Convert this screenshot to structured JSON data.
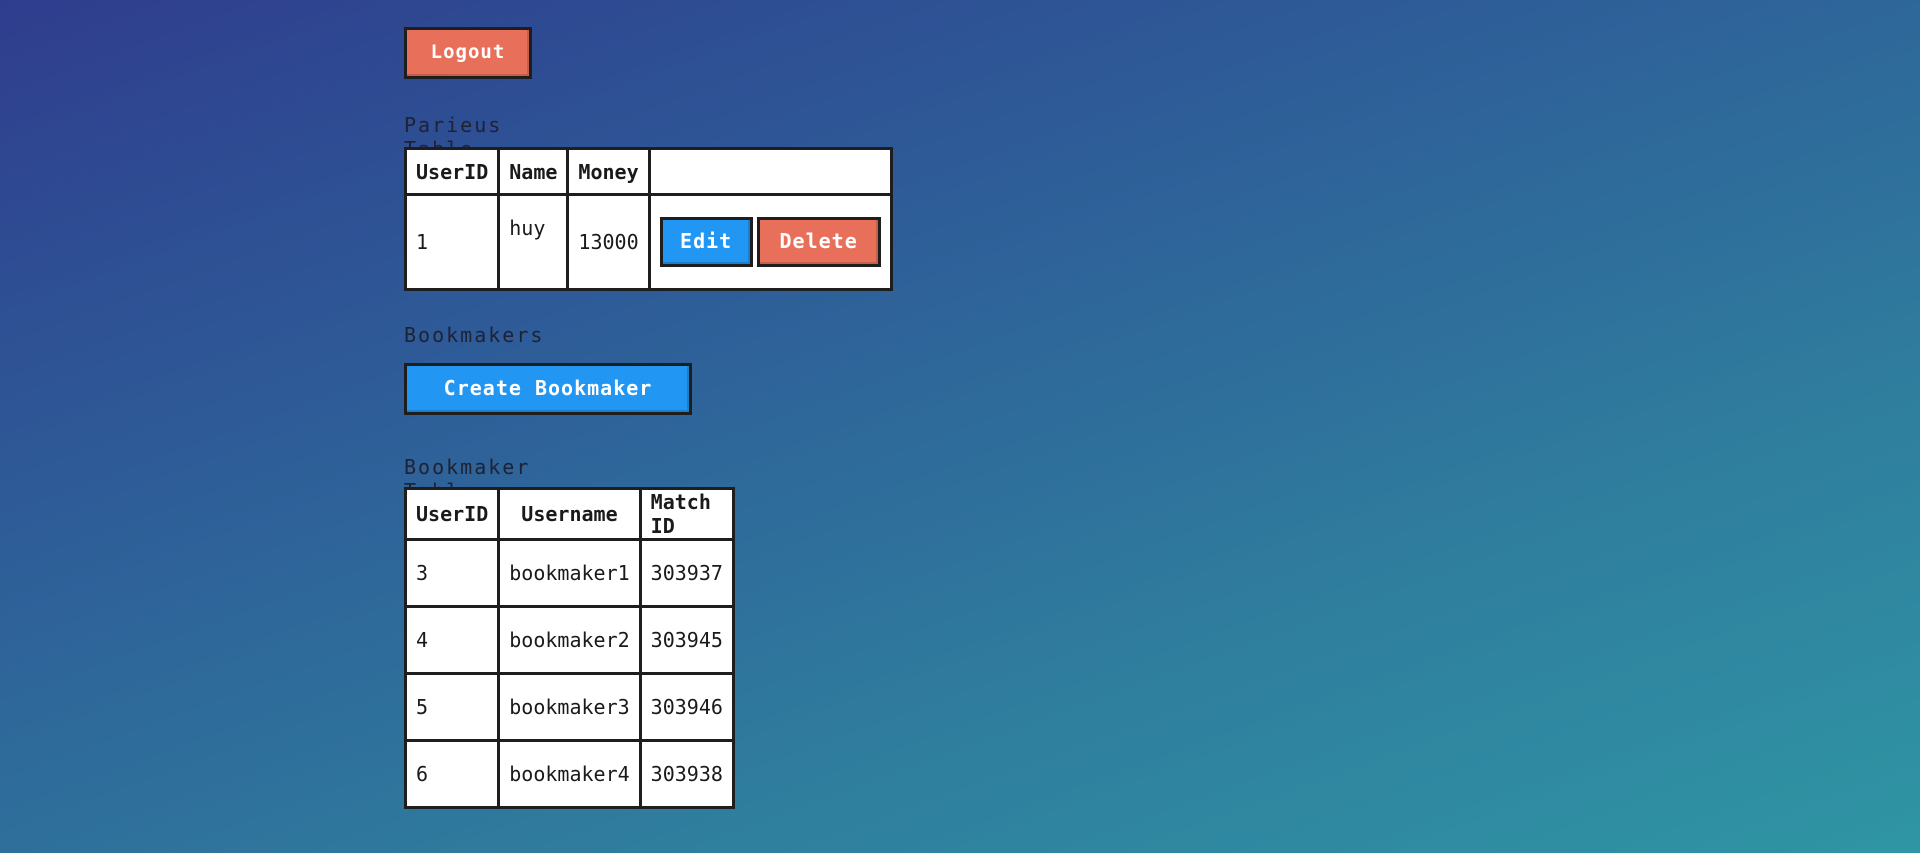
{
  "header": {
    "logout_label": "Logout"
  },
  "parieus": {
    "title": "Parieus Table",
    "columns": [
      "UserID",
      "Name",
      "Money",
      ""
    ],
    "rows": [
      {
        "user_id": "1",
        "name": "huy",
        "money": "13000",
        "edit_label": "Edit",
        "delete_label": "Delete"
      }
    ]
  },
  "bookmakers": {
    "title": "Bookmakers",
    "create_label": "Create Bookmaker",
    "table_title": "Bookmaker Table",
    "columns": [
      "UserID",
      "Username",
      "Match ID"
    ],
    "rows": [
      {
        "user_id": "3",
        "username": "bookmaker1",
        "match_id": "303937"
      },
      {
        "user_id": "4",
        "username": "bookmaker2",
        "match_id": "303945"
      },
      {
        "user_id": "5",
        "username": "bookmaker3",
        "match_id": "303946"
      },
      {
        "user_id": "6",
        "username": "bookmaker4",
        "match_id": "303938"
      }
    ]
  },
  "colors": {
    "primary": "#2196f3",
    "danger": "#e8705a",
    "border": "#1e1e1e"
  }
}
